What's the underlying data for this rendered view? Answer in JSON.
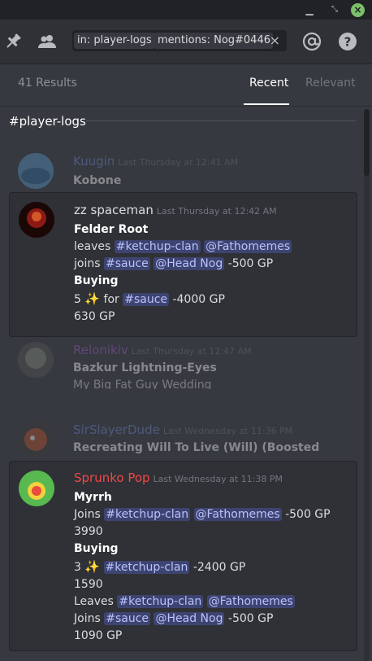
{
  "titlebar": {
    "min_icon": "minimize-icon",
    "max_icon": "maximize-icon",
    "close_icon": "close-icon",
    "close_color": "#7ac16a"
  },
  "toolbar": {
    "search_chip_1": "in: player-logs",
    "search_chip_2": "mentions: Nog#0446",
    "clear": "×"
  },
  "results": {
    "count": "41 Results",
    "tab_recent": "Recent",
    "tab_relevant": "Relevant"
  },
  "channel": {
    "name": "#player-logs"
  },
  "messages": {
    "m1": {
      "user": "Kuugin",
      "time": "Last Thursday at 12:41 AM",
      "l1": "Kobone"
    },
    "m2": {
      "user": "zz spaceman",
      "time": "Last Thursday at 12:42 AM",
      "l1": "Felder Root",
      "l2_a": "leaves",
      "l2_ch": "#ketchup-clan",
      "l2_user": "@Fathomemes",
      "l3_a": "joins",
      "l3_ch": "#sauce",
      "l3_user": "@Head Nog",
      "l3_gp": "-500 GP",
      "l4": "Buying",
      "l5_n": "5",
      "l5_for": "for",
      "l5_ch": "#sauce",
      "l5_gp": "-4000 GP",
      "l6": "630 GP"
    },
    "m3": {
      "user": "Relonikiv",
      "time": "Last Thursday at 12:47 AM",
      "l1": "Bazkur Lightning-Eyes",
      "l2": "My Big Fat Guy Wedding"
    },
    "m4": {
      "user": "SirSlayerDude",
      "time": "Last Wednesday at 11:36 PM",
      "l1": "Recreating Will To Live (Will) (Boosted"
    },
    "m5": {
      "user": "Sprunko Pop",
      "time": "Last Wednesday at 11:38 PM",
      "l1": "Myrrh",
      "l2_a": "Joins",
      "l2_ch": "#ketchup-clan",
      "l2_user": "@Fathomemes",
      "l2_gp": "-500 GP",
      "l3": "3990",
      "l4": "Buying",
      "l5_n": "3",
      "l5_ch": "#ketchup-clan",
      "l5_gp": "-2400 GP",
      "l6": "1590",
      "l7_a": "Leaves",
      "l7_ch": "#ketchup-clan",
      "l7_user": "@Fathomemes",
      "l8_a": "Joins",
      "l8_ch": "#sauce",
      "l8_user": "@Head Nog",
      "l8_gp": "-500 GP",
      "l9": "1090 GP"
    }
  },
  "colors": {
    "bg": "#36393f",
    "card": "#2f3136",
    "mention_bg": "#3e4470",
    "mention_fg": "#b7c2ff",
    "user_red": "#f04747",
    "user_gray": "#dcddde",
    "user_blue": "#7289da",
    "user_purple": "#a15dd4"
  }
}
